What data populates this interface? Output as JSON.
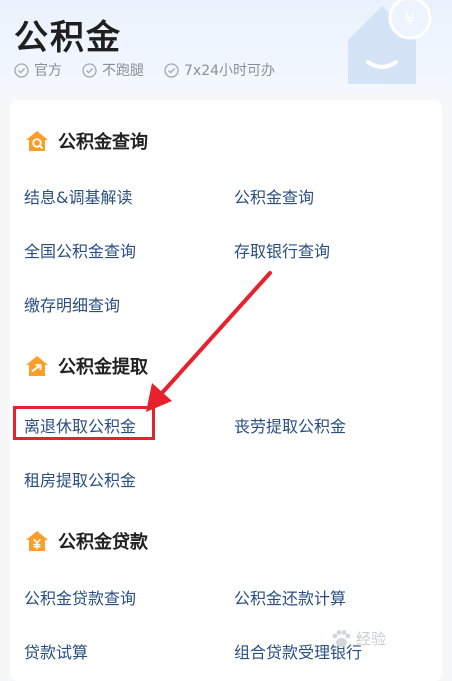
{
  "header": {
    "title": "公积金",
    "tags": [
      "官方",
      "不跑腿",
      "7x24小时可办"
    ]
  },
  "sections": [
    {
      "title": "公积金查询",
      "items": [
        "结息&调基解读",
        "公积金查询",
        "全国公积金查询",
        "存取银行查询",
        "缴存明细查询"
      ]
    },
    {
      "title": "公积金提取",
      "items": [
        "离退休取公积金",
        "丧劳提取公积金",
        "租房提取公积金"
      ]
    },
    {
      "title": "公积金贷款",
      "items": [
        "公积金贷款查询",
        "公积金还款计算",
        "贷款试算",
        "组合贷款受理银行"
      ]
    }
  ],
  "watermark": "经验",
  "colors": {
    "accent_orange": "#ff9d29",
    "link_blue": "#2a4f80",
    "highlight_red": "#e8212c"
  }
}
